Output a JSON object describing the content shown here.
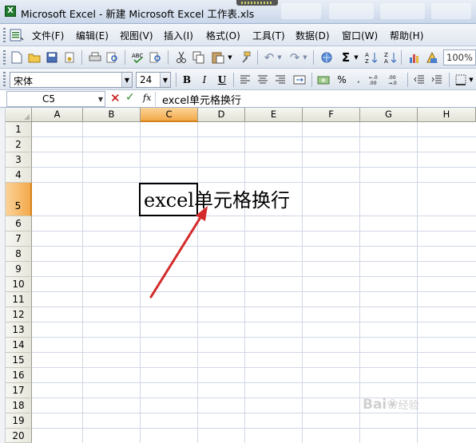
{
  "window": {
    "title": "Microsoft Excel - 新建 Microsoft Excel 工作表.xls"
  },
  "menu": {
    "items": [
      {
        "label": "文件(F)"
      },
      {
        "label": "编辑(E)"
      },
      {
        "label": "视图(V)"
      },
      {
        "label": "插入(I)"
      },
      {
        "label": "格式(O)"
      },
      {
        "label": "工具(T)"
      },
      {
        "label": "数据(D)"
      },
      {
        "label": "窗口(W)"
      },
      {
        "label": "帮助(H)"
      }
    ]
  },
  "standard_toolbar": {
    "zoom": "100%"
  },
  "formatting_toolbar": {
    "font_name": "宋体",
    "font_size": "24",
    "bold": "B",
    "italic": "I",
    "underline": "U",
    "percent": "%"
  },
  "formula_bar": {
    "name_box": "C5",
    "fx_label": "fx",
    "content": "excel单元格换行"
  },
  "sheet": {
    "columns": [
      "A",
      "B",
      "C",
      "D",
      "E",
      "F",
      "G",
      "H"
    ],
    "rows": [
      "1",
      "2",
      "3",
      "4",
      "5",
      "6",
      "7",
      "8",
      "9",
      "10",
      "11",
      "12",
      "13",
      "14",
      "15",
      "16",
      "17",
      "18",
      "19",
      "20"
    ],
    "active_column": "C",
    "active_row": "5",
    "cell_c5": "excel单元格换行"
  },
  "watermark": {
    "text": "Bai",
    "sub": "经验"
  },
  "colors": {
    "active_header": "#f3a94a",
    "arrow": "#d42a2a",
    "grid_line": "#d0d7e5"
  }
}
